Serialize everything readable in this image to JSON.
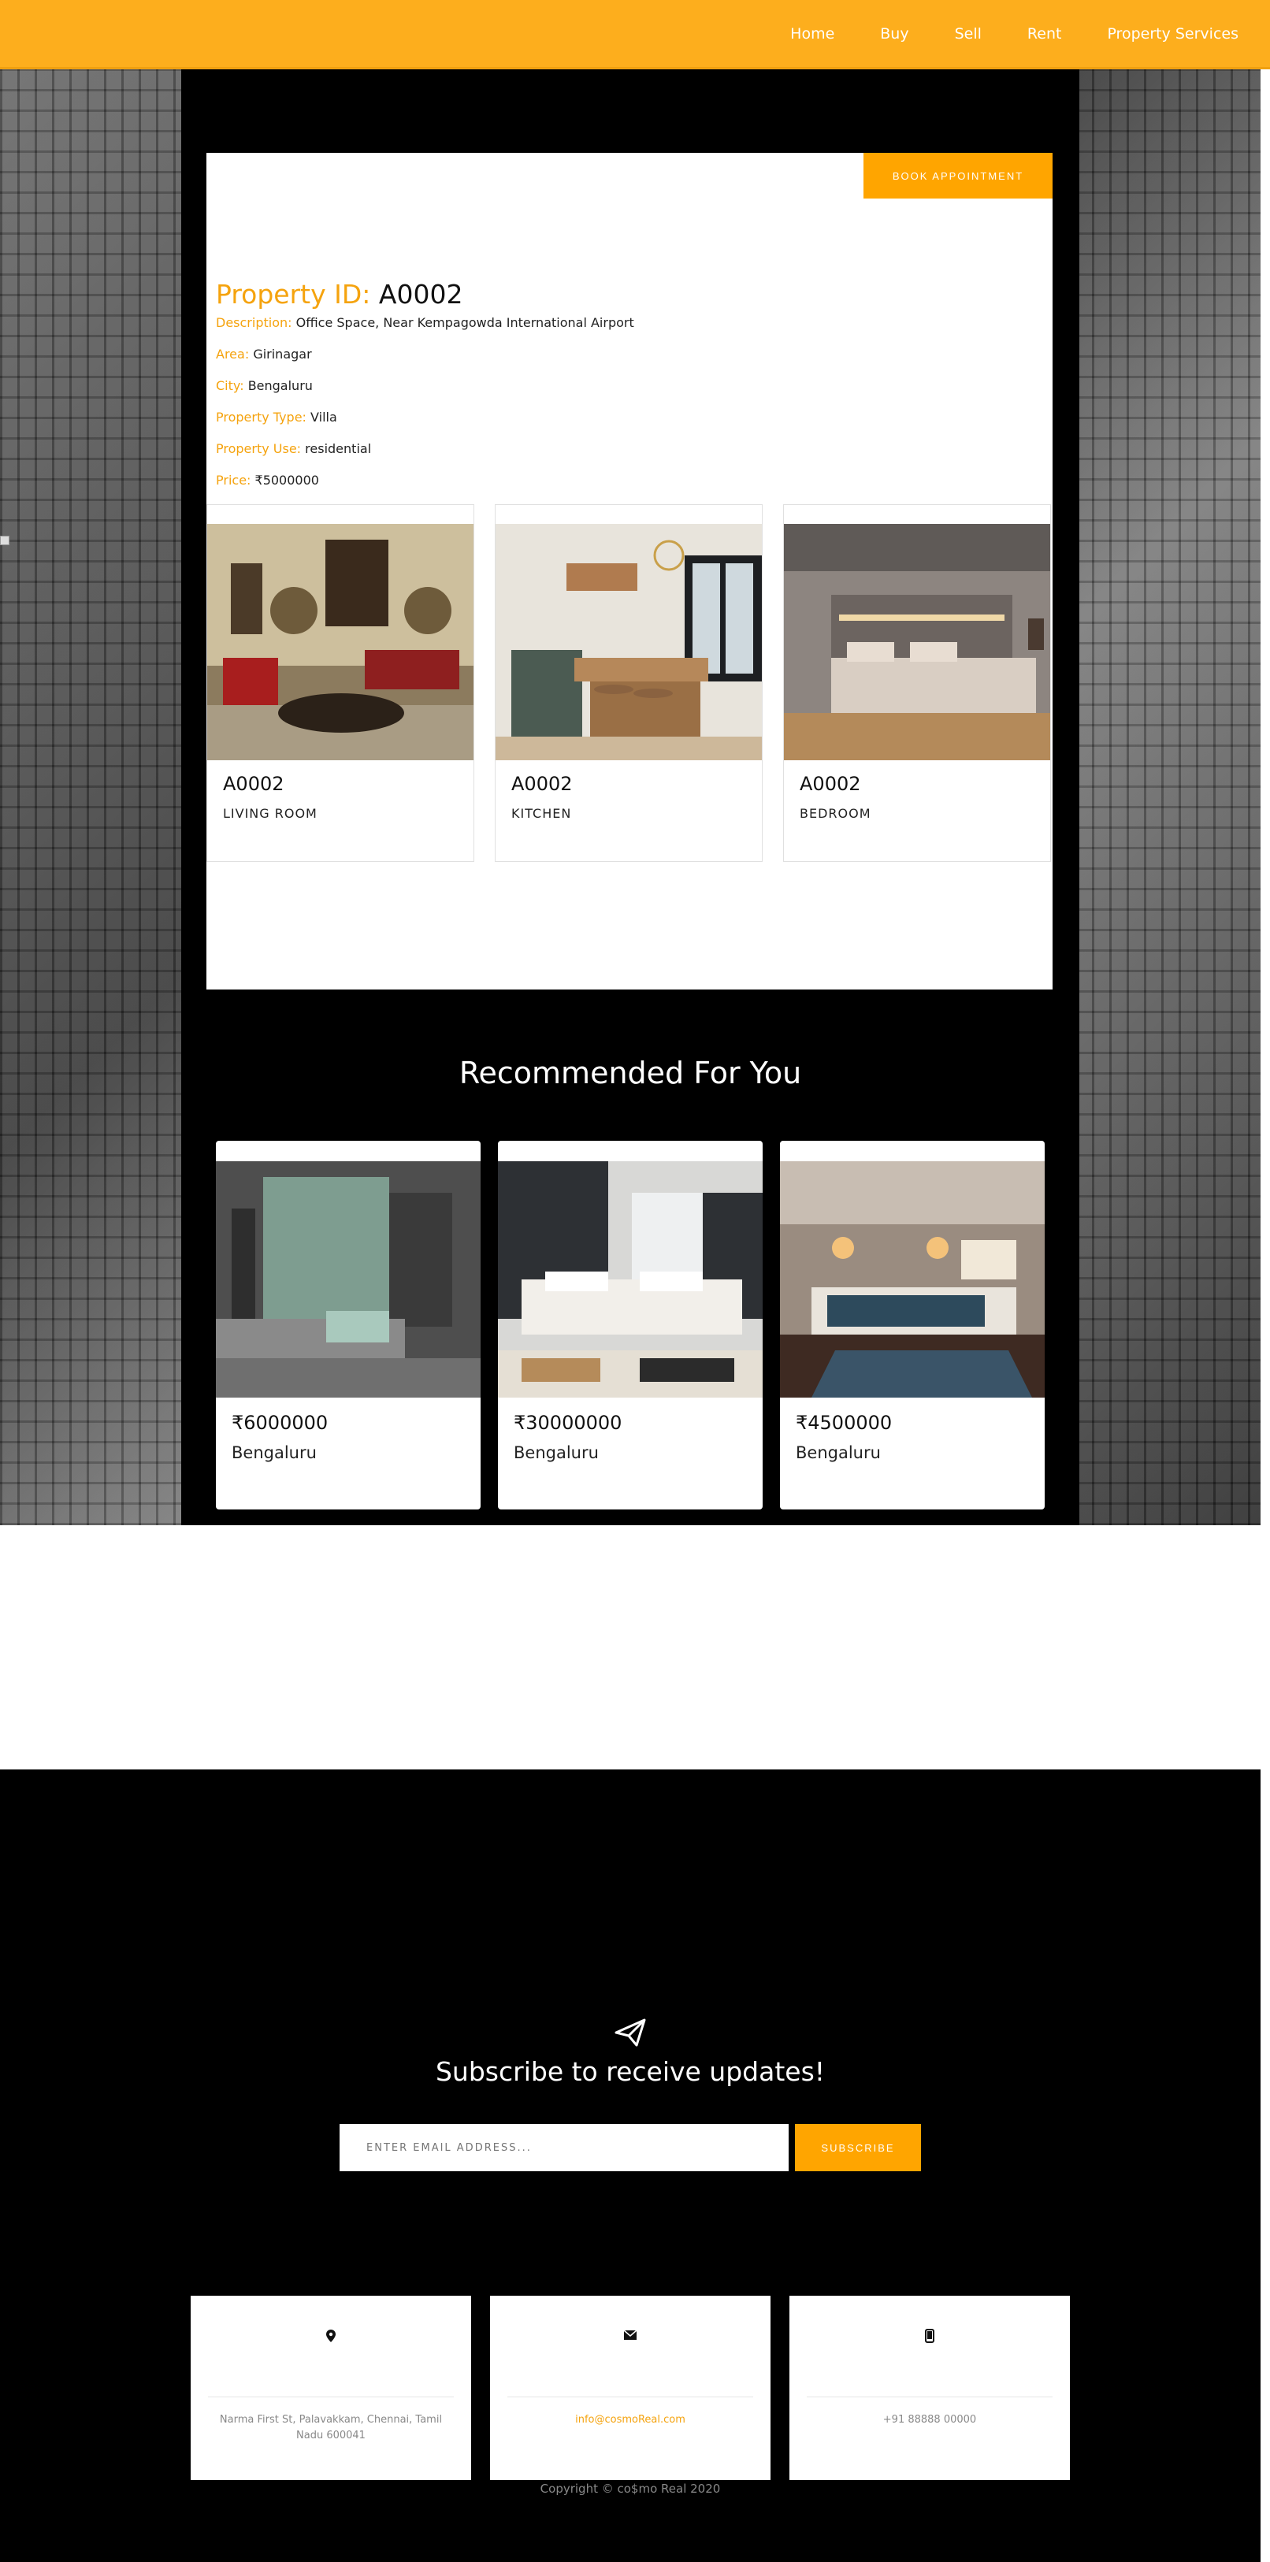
{
  "nav": {
    "links": [
      "Home",
      "Buy",
      "Sell",
      "Rent",
      "Property Services"
    ]
  },
  "property": {
    "book_button": "BOOK APPOINTMENT",
    "id_label": "Property ID:",
    "id_value": "A0002",
    "details": [
      {
        "label": "Description:",
        "value": "Office Space, Near Kempagowda International Airport"
      },
      {
        "label": "Area:",
        "value": "Girinagar"
      },
      {
        "label": "City:",
        "value": "Bengaluru"
      },
      {
        "label": "Property Type:",
        "value": "Villa"
      },
      {
        "label": "Property Use:",
        "value": "residential"
      },
      {
        "label": "Price:",
        "value": "₹5000000"
      }
    ],
    "rooms": [
      {
        "id": "A0002",
        "name": "LIVING ROOM"
      },
      {
        "id": "A0002",
        "name": "KITCHEN"
      },
      {
        "id": "A0002",
        "name": "BEDROOM"
      }
    ]
  },
  "recommended": {
    "title": "Recommended For You",
    "items": [
      {
        "price": "₹6000000",
        "city": "Bengaluru"
      },
      {
        "price": "₹30000000",
        "city": "Bengaluru"
      },
      {
        "price": "₹4500000",
        "city": "Bengaluru"
      }
    ]
  },
  "footer": {
    "subscribe_title": "Subscribe to receive updates!",
    "email_placeholder": "ENTER EMAIL ADDRESS...",
    "subscribe_button": "SUBSCRIBE",
    "contacts": [
      {
        "icon": "map-icon",
        "text": "Narma First St, Palavakkam, Chennai, Tamil Nadu 600041"
      },
      {
        "icon": "envelope-icon",
        "text": "info@cosmoReal.com"
      },
      {
        "icon": "mobile-icon",
        "text": "+91 88888 00000"
      }
    ],
    "copyright": "Copyright © co$mo Real 2020"
  },
  "colors": {
    "accent": "#ffa500",
    "navbar": "#fdae1d",
    "label": "#f5a30e"
  }
}
